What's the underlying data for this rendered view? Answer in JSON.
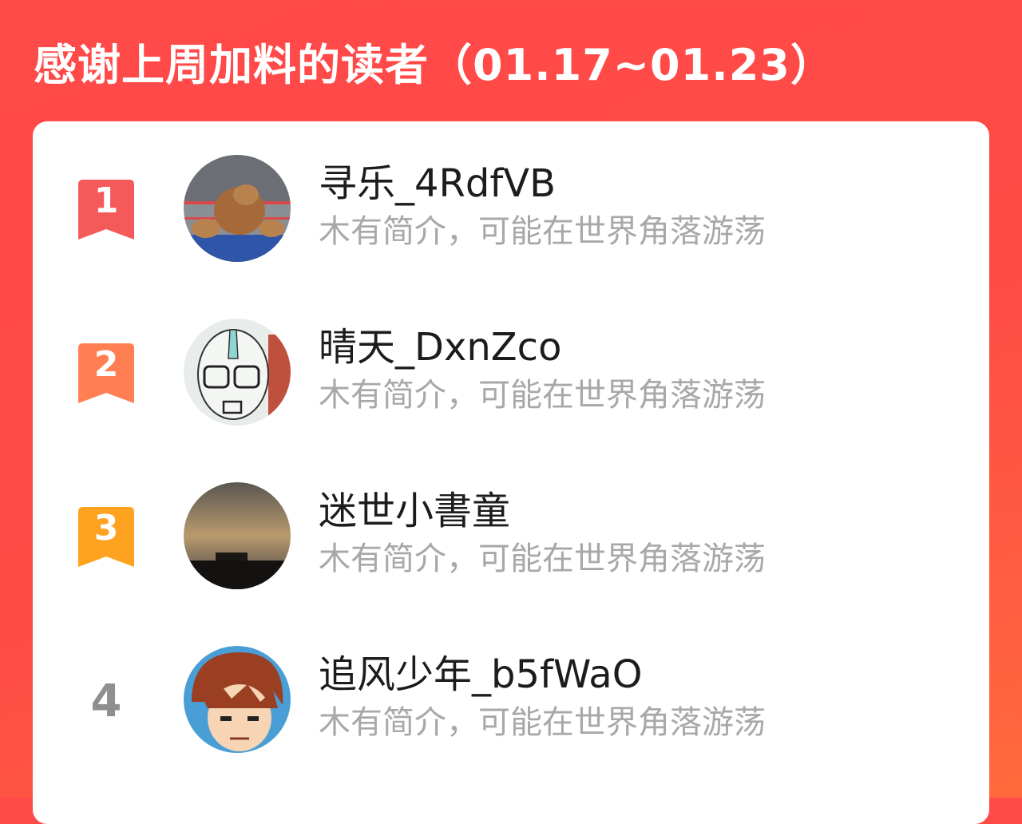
{
  "header": {
    "title": "感谢上周加料的读者（01.17~01.23）"
  },
  "readers": [
    {
      "rank": "1",
      "rank_color": "#f55a5a",
      "name": "寻乐_4RdfVB",
      "bio": "木有简介，可能在世界角落游荡"
    },
    {
      "rank": "2",
      "rank_color": "#ff7f52",
      "name": "晴天_DxnZco",
      "bio": "木有简介，可能在世界角落游荡"
    },
    {
      "rank": "3",
      "rank_color": "#ffa21f",
      "name": "迷世小書童",
      "bio": "木有简介，可能在世界角落游荡"
    },
    {
      "rank": "4",
      "rank_color": "#8f8f8f",
      "name": "追风少年_b5fWaO",
      "bio": "木有简介，可能在世界角落游荡"
    }
  ]
}
